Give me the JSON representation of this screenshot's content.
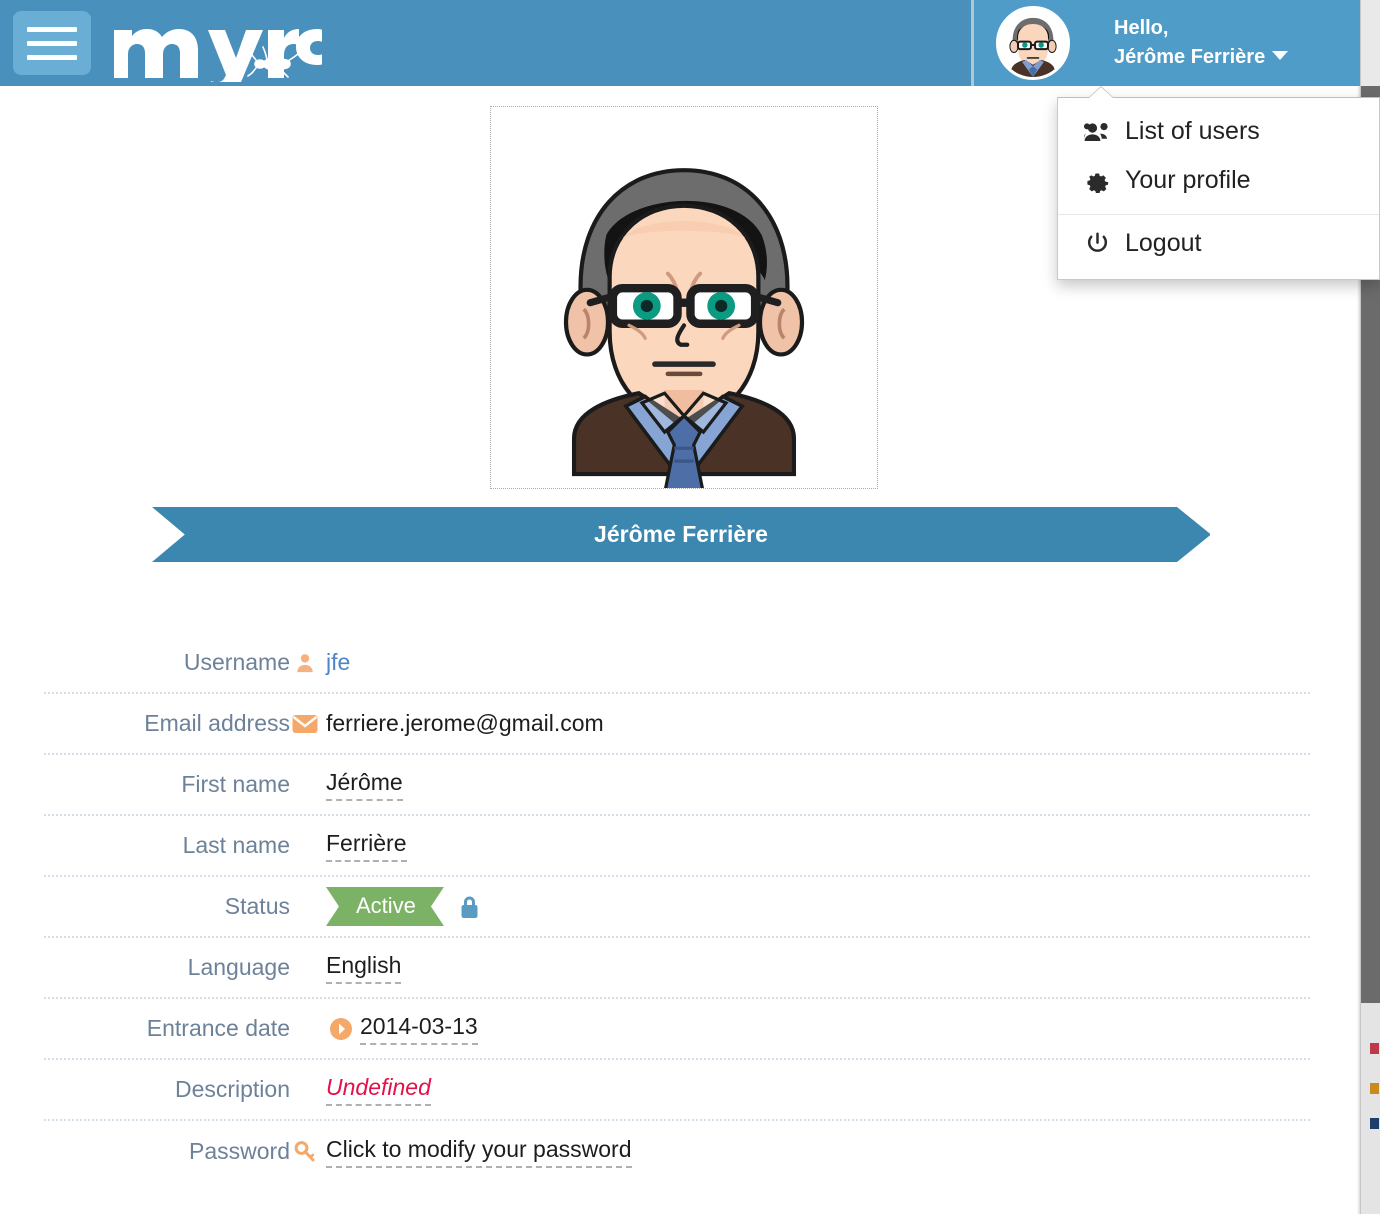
{
  "app": {
    "brand_name": "myra",
    "brand_icon": "ant-icon",
    "menu_icon": "hamburger-menu-icon",
    "header_color": "#4a90bd",
    "accent_color": "#3c87b0",
    "label_color": "#6d8299",
    "link_color": "#4a86c8",
    "icon_orange": "#f5a868",
    "status_green": "#7cb266",
    "undefined_red": "#e1134a"
  },
  "header": {
    "greeting": "Hello,",
    "user_name": "Jérôme Ferrière",
    "avatar_icon": "user-avatar",
    "caret_icon": "chevron-down-icon"
  },
  "dropdown": {
    "items": [
      {
        "label": "List of users",
        "icon": "users-icon"
      },
      {
        "label": "Your profile",
        "icon": "gear-icon"
      },
      {
        "label": "Logout",
        "icon": "power-icon"
      }
    ]
  },
  "profile": {
    "photo_alt": "user-profile-photo",
    "name_banner": "Jérôme Ferrière"
  },
  "fields": [
    {
      "label": "Username",
      "icon": "user-icon",
      "value": "jfe",
      "style": "link"
    },
    {
      "label": "Email address",
      "icon": "envelope-icon",
      "value": "ferriere.jerome@gmail.com",
      "style": "plain"
    },
    {
      "label": "First name",
      "icon": "none",
      "value": "Jérôme",
      "style": "dashed"
    },
    {
      "label": "Last name",
      "icon": "none",
      "value": "Ferrière",
      "style": "dashed"
    },
    {
      "label": "Status",
      "icon": "lock-icon",
      "value": "Active",
      "style": "badge"
    },
    {
      "label": "Language",
      "icon": "none",
      "value": "English",
      "style": "dashed"
    },
    {
      "label": "Entrance date",
      "icon": "arrow-circle-right-icon",
      "value": "2014-03-13",
      "style": "dashed"
    },
    {
      "label": "Description",
      "icon": "none",
      "value": "Undefined",
      "style": "undefined"
    },
    {
      "label": "Password",
      "icon": "key-icon",
      "value": "Click to modify your password",
      "style": "dashed"
    }
  ]
}
